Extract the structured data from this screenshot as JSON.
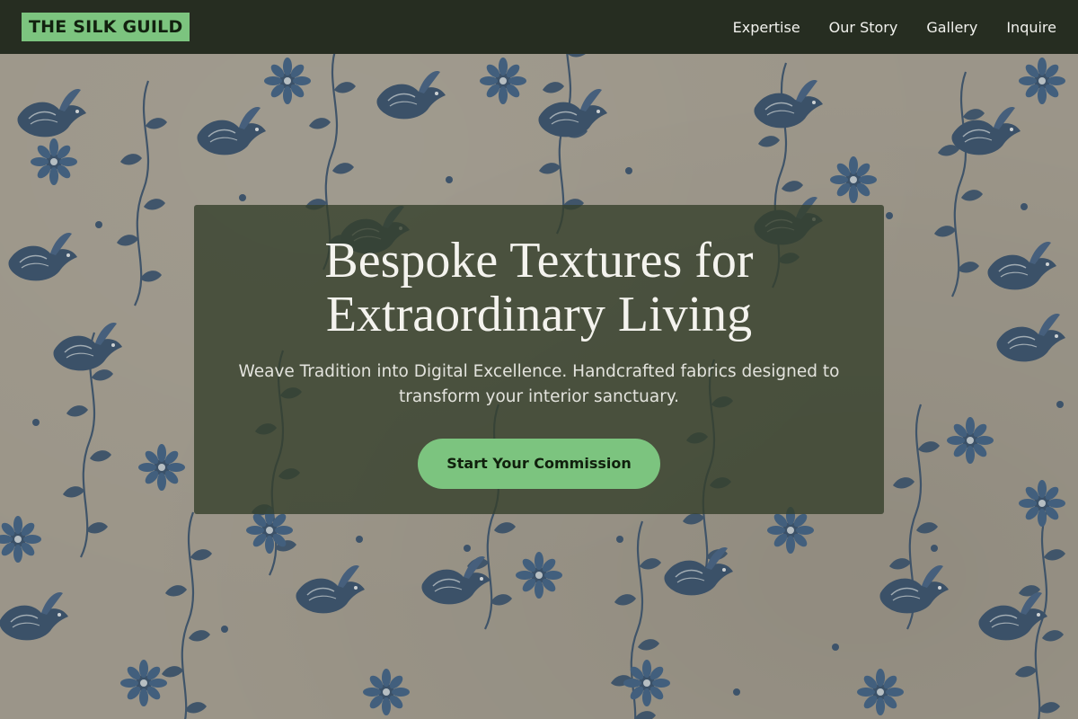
{
  "brand": {
    "name": "THE SILK GUILD",
    "accent": "#7cc47f"
  },
  "nav": {
    "links": [
      {
        "label": "Expertise"
      },
      {
        "label": "Our Story"
      },
      {
        "label": "Gallery"
      },
      {
        "label": "Inquire"
      }
    ]
  },
  "hero": {
    "title_line1": "Bespoke Textures for",
    "title_line2": "Extraordinary Living",
    "subtitle": "Weave Tradition into Digital Excellence. Handcrafted fabrics designed to transform your interior sanctuary.",
    "cta_label": "Start Your Commission"
  },
  "background": {
    "description_icon": "floral-fabric-pattern",
    "ink": "#2f4a6b"
  }
}
